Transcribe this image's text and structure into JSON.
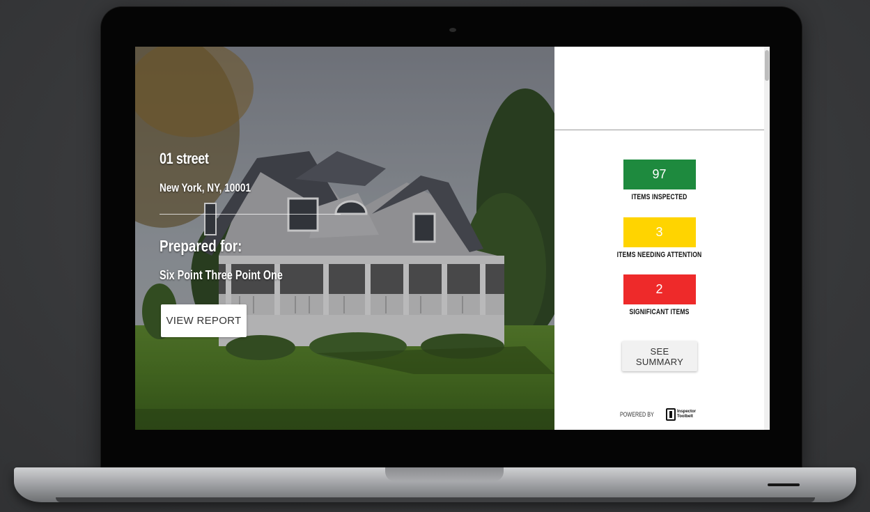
{
  "hero": {
    "address_line1": "01 street",
    "address_line2": "New York, NY, 10001",
    "prepared_label": "Prepared for:",
    "client_name": "Six Point Three Point One",
    "view_report_label": "VIEW REPORT"
  },
  "stats": [
    {
      "value": "97",
      "label": "ITEMS INSPECTED",
      "color": "#1e8a3e"
    },
    {
      "value": "3",
      "label": "ITEMS NEEDING ATTENTION",
      "color": "#ffd400"
    },
    {
      "value": "2",
      "label": "SIGNIFICANT ITEMS",
      "color": "#ee2a2a"
    }
  ],
  "summary_button_label": "SEE SUMMARY",
  "footer": {
    "powered_by": "POWERED BY",
    "brand_line1": "Inspector",
    "brand_line2": "Toolbelt"
  }
}
